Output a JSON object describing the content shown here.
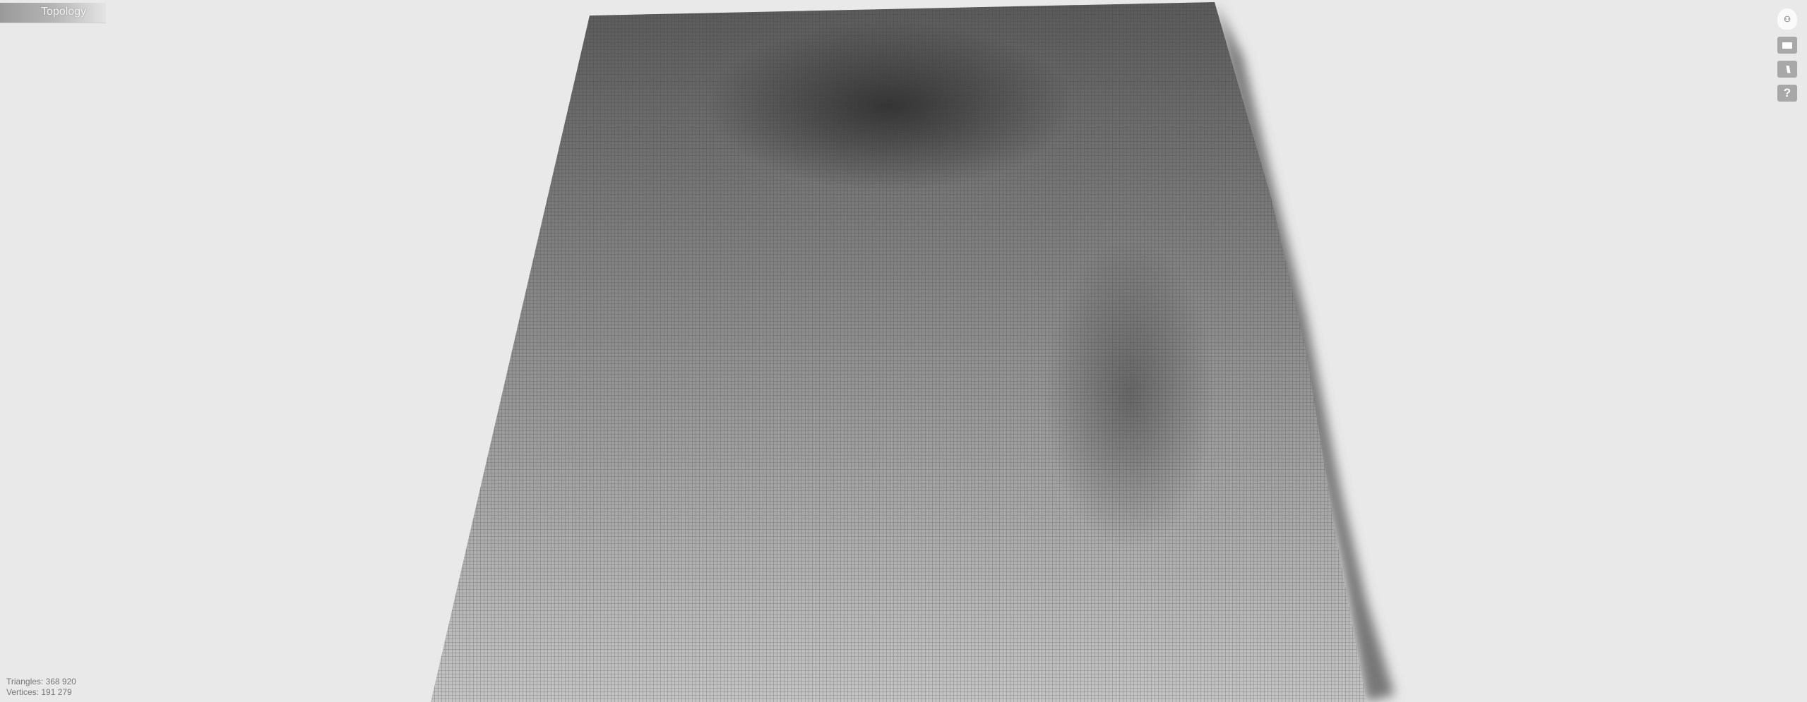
{
  "app": {
    "title": "Topology"
  },
  "toolbar": {
    "items": [
      {
        "name": "orientation-cube",
        "icon": "cube-icon"
      },
      {
        "name": "view-mode",
        "icon": "rectangle-icon"
      },
      {
        "name": "wireframe",
        "icon": "stripes-icon"
      },
      {
        "name": "help",
        "icon": "question-icon",
        "label": "?"
      }
    ]
  },
  "stats": {
    "triangles": "Triangles: 368 920",
    "vertices": "Vertices: 191 279"
  }
}
